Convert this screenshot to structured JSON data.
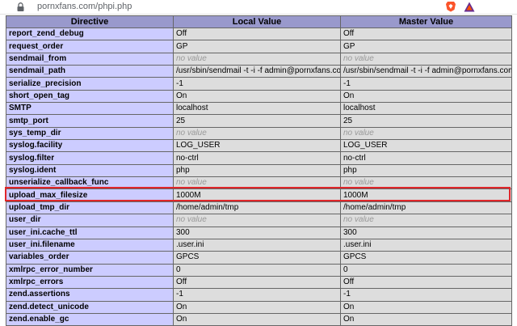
{
  "browser": {
    "url": "pornxfans.com/phpi.php",
    "icons": [
      "lock-icon",
      "brave-shield-icon",
      "bat-rewards-icon"
    ]
  },
  "table": {
    "headers": [
      "Directive",
      "Local Value",
      "Master Value"
    ],
    "rows": [
      {
        "directive": "report_zend_debug",
        "local": "Off",
        "master": "Off"
      },
      {
        "directive": "request_order",
        "local": "GP",
        "master": "GP"
      },
      {
        "directive": "sendmail_from",
        "local": "no value",
        "master": "no value"
      },
      {
        "directive": "sendmail_path",
        "local": "/usr/sbin/sendmail -t -i -f admin@pornxfans.com",
        "master": "/usr/sbin/sendmail -t -i -f admin@pornxfans.com"
      },
      {
        "directive": "serialize_precision",
        "local": "-1",
        "master": "-1"
      },
      {
        "directive": "short_open_tag",
        "local": "On",
        "master": "On"
      },
      {
        "directive": "SMTP",
        "local": "localhost",
        "master": "localhost"
      },
      {
        "directive": "smtp_port",
        "local": "25",
        "master": "25"
      },
      {
        "directive": "sys_temp_dir",
        "local": "no value",
        "master": "no value"
      },
      {
        "directive": "syslog.facility",
        "local": "LOG_USER",
        "master": "LOG_USER"
      },
      {
        "directive": "syslog.filter",
        "local": "no-ctrl",
        "master": "no-ctrl"
      },
      {
        "directive": "syslog.ident",
        "local": "php",
        "master": "php"
      },
      {
        "directive": "unserialize_callback_func",
        "local": "no value",
        "master": "no value"
      },
      {
        "directive": "upload_max_filesize",
        "local": "1000M",
        "master": "1000M"
      },
      {
        "directive": "upload_tmp_dir",
        "local": "/home/admin/tmp",
        "master": "/home/admin/tmp"
      },
      {
        "directive": "user_dir",
        "local": "no value",
        "master": "no value"
      },
      {
        "directive": "user_ini.cache_ttl",
        "local": "300",
        "master": "300"
      },
      {
        "directive": "user_ini.filename",
        "local": ".user.ini",
        "master": ".user.ini"
      },
      {
        "directive": "variables_order",
        "local": "GPCS",
        "master": "GPCS"
      },
      {
        "directive": "xmlrpc_error_number",
        "local": "0",
        "master": "0"
      },
      {
        "directive": "xmlrpc_errors",
        "local": "Off",
        "master": "Off"
      },
      {
        "directive": "zend.assertions",
        "local": "-1",
        "master": "-1"
      },
      {
        "directive": "zend.detect_unicode",
        "local": "On",
        "master": "On"
      },
      {
        "directive": "zend.enable_gc",
        "local": "On",
        "master": "On"
      }
    ],
    "highlighted_directive": "upload_max_filesize"
  },
  "colors": {
    "header_bg": "#9999cc",
    "directive_bg": "#ccccff",
    "value_bg": "#dddddd",
    "no_value_text": "#999999",
    "highlight_border": "#e0262a"
  }
}
